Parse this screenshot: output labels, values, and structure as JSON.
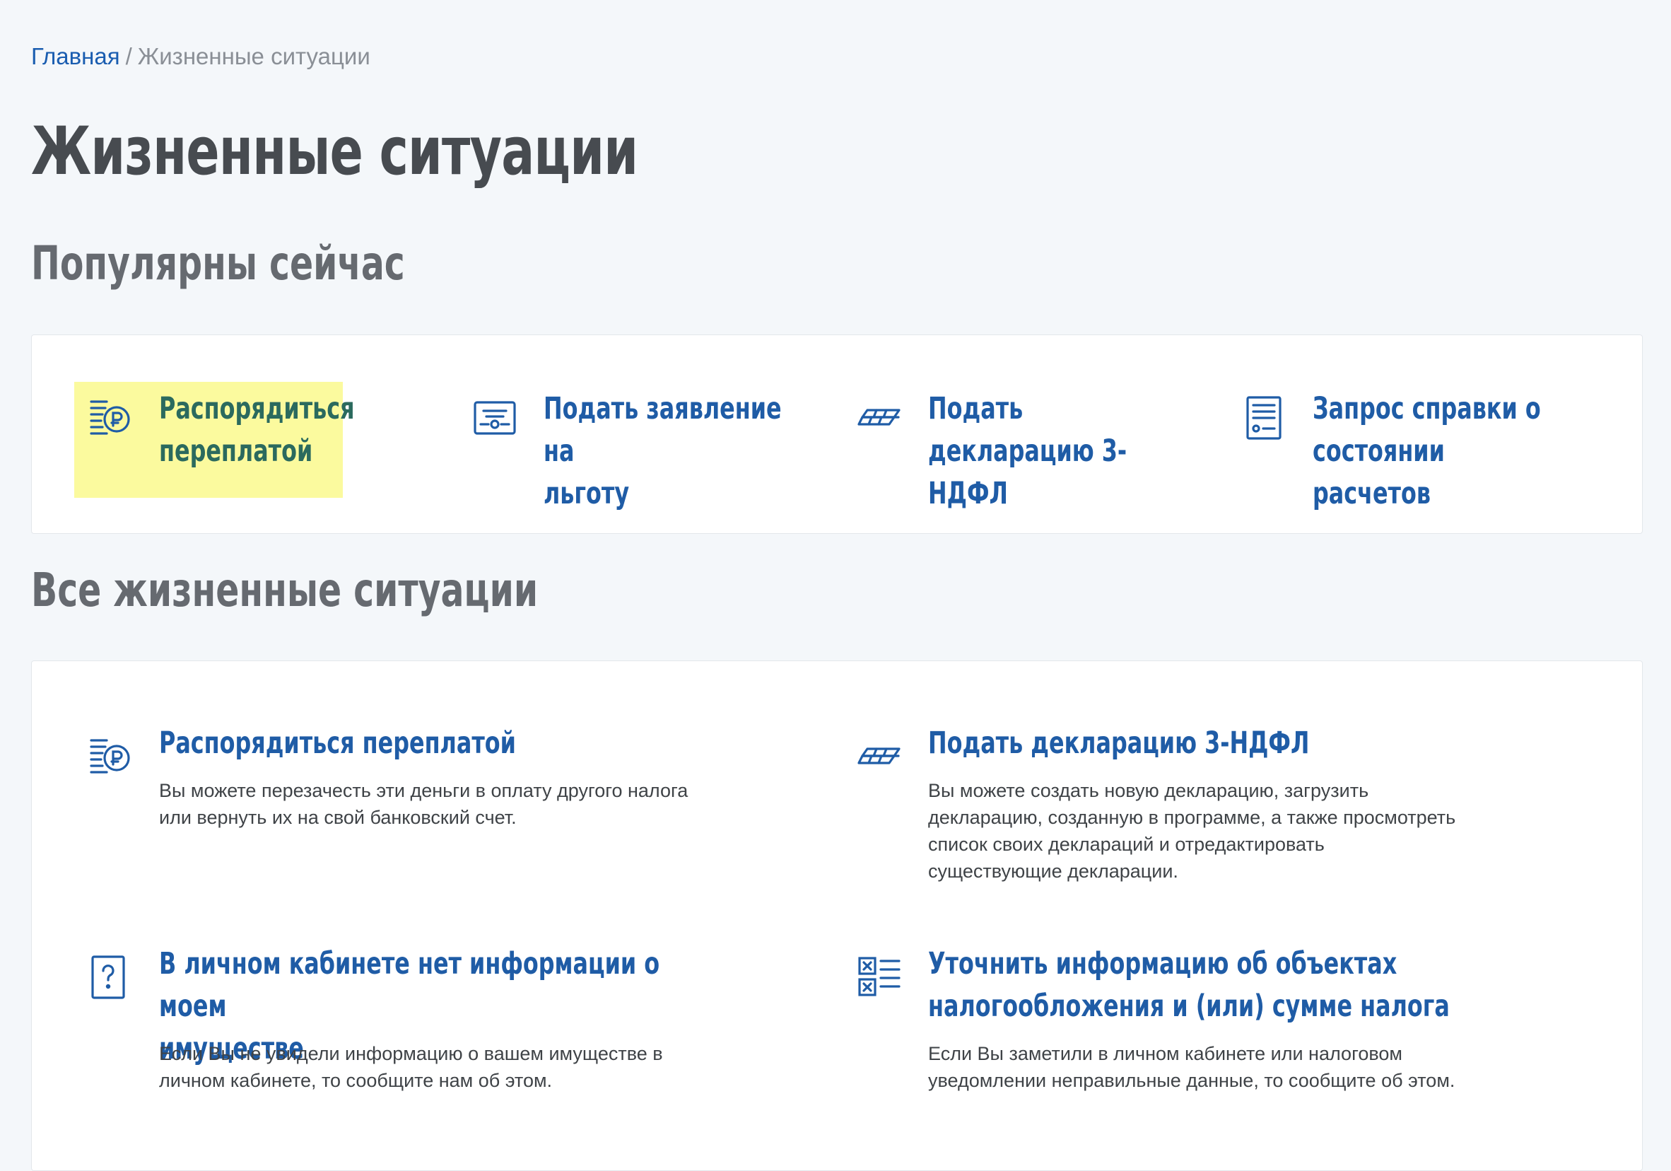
{
  "breadcrumb": {
    "home": "Главная",
    "separator": "/",
    "current": "Жизненные ситуации"
  },
  "page_title": "Жизненные ситуации",
  "popular": {
    "heading": "Популярны сейчас",
    "items": [
      {
        "line1": "Распорядиться",
        "line2": "переплатой",
        "icon": "coins-ruble-icon",
        "highlighted": true
      },
      {
        "line1": "Подать заявление на",
        "line2": "льготу",
        "icon": "certificate-icon",
        "highlighted": false
      },
      {
        "line1": "Подать декларацию 3-",
        "line2": "НДФЛ",
        "icon": "documents-stack-icon",
        "highlighted": false
      },
      {
        "line1": "Запрос справки о",
        "line2": "состоянии расчетов",
        "icon": "document-list-icon",
        "highlighted": false
      }
    ]
  },
  "all": {
    "heading": "Все жизненные ситуации",
    "items": [
      {
        "title_line1": "Распорядиться переплатой",
        "title_line2": "",
        "desc_line1": "Вы можете перезачесть эти деньги в оплату другого налога",
        "desc_line2": "или вернуть их на свой банковский счет.",
        "desc_line3": "",
        "desc_line4": "",
        "icon": "coins-ruble-icon"
      },
      {
        "title_line1": "Подать декларацию 3-НДФЛ",
        "title_line2": "",
        "desc_line1": "Вы можете создать новую декларацию, загрузить",
        "desc_line2": "декларацию, созданную в программе, а также просмотреть",
        "desc_line3": "список своих деклараций и отредактировать",
        "desc_line4": "существующие декларации.",
        "icon": "documents-stack-icon"
      },
      {
        "title_line1": "В личном кабинете нет информации о моем",
        "title_line2": "имуществе",
        "desc_line1": "Если Вы не увидели информацию о вашем имуществе в",
        "desc_line2": "личном кабинете, то сообщите нам об этом.",
        "desc_line3": "",
        "desc_line4": "",
        "icon": "question-document-icon"
      },
      {
        "title_line1": "Уточнить информацию об объектах",
        "title_line2": "налогообложения и (или) сумме налога",
        "desc_line1": "Если Вы заметили в личном кабинете или налоговом",
        "desc_line2": "уведомлении неправильные данные, то сообщите об этом.",
        "desc_line3": "",
        "desc_line4": "",
        "icon": "checklist-icon"
      }
    ]
  },
  "colors": {
    "link": "#1f5ca6",
    "highlight_bg": "#fbfa9e",
    "highlight_text": "#2b6a5e",
    "page_bg": "#f4f7fa"
  }
}
